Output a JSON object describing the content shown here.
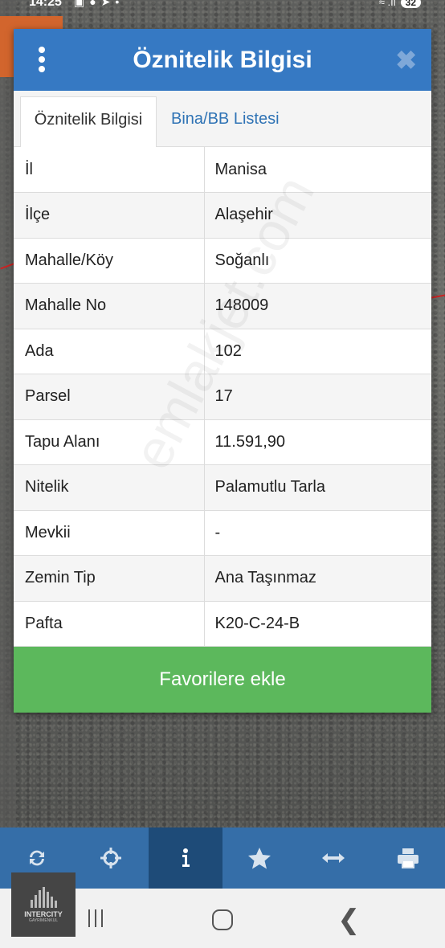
{
  "status_bar": {
    "time": "14:25",
    "battery": "32"
  },
  "dialog": {
    "title": "Öznitelik Bilgisi",
    "tabs": [
      {
        "label": "Öznitelik Bilgisi",
        "active": true
      },
      {
        "label": "Bina/BB Listesi",
        "active": false
      }
    ],
    "rows": [
      {
        "key": "İl",
        "value": "Manisa"
      },
      {
        "key": "İlçe",
        "value": "Alaşehir"
      },
      {
        "key": "Mahalle/Köy",
        "value": "Soğanlı"
      },
      {
        "key": "Mahalle No",
        "value": "148009"
      },
      {
        "key": "Ada",
        "value": "102"
      },
      {
        "key": "Parsel",
        "value": "17"
      },
      {
        "key": "Tapu Alanı",
        "value": "11.591,90"
      },
      {
        "key": "Nitelik",
        "value": "Palamutlu Tarla"
      },
      {
        "key": "Mevkii",
        "value": "-"
      },
      {
        "key": "Zemin Tip",
        "value": "Ana Taşınmaz"
      },
      {
        "key": "Pafta",
        "value": "K20-C-24-B"
      }
    ],
    "favorite_button": "Favorilere ekle"
  },
  "watermark": "emlakjet.com",
  "logo": {
    "name": "INTERCITY",
    "subtitle": "GAYRİMENKUL"
  },
  "toolbar": {
    "items": [
      {
        "icon": "refresh-icon",
        "active": false
      },
      {
        "icon": "crosshair-icon",
        "active": false
      },
      {
        "icon": "info-icon",
        "active": true
      },
      {
        "icon": "star-icon",
        "active": false
      },
      {
        "icon": "measure-arrows-icon",
        "active": false
      },
      {
        "icon": "print-icon",
        "active": false
      }
    ]
  },
  "colors": {
    "header": "#3679c3",
    "favorite": "#5cb85c",
    "toolbar": "#356ea8",
    "toolbar_active": "#1e4b78"
  }
}
